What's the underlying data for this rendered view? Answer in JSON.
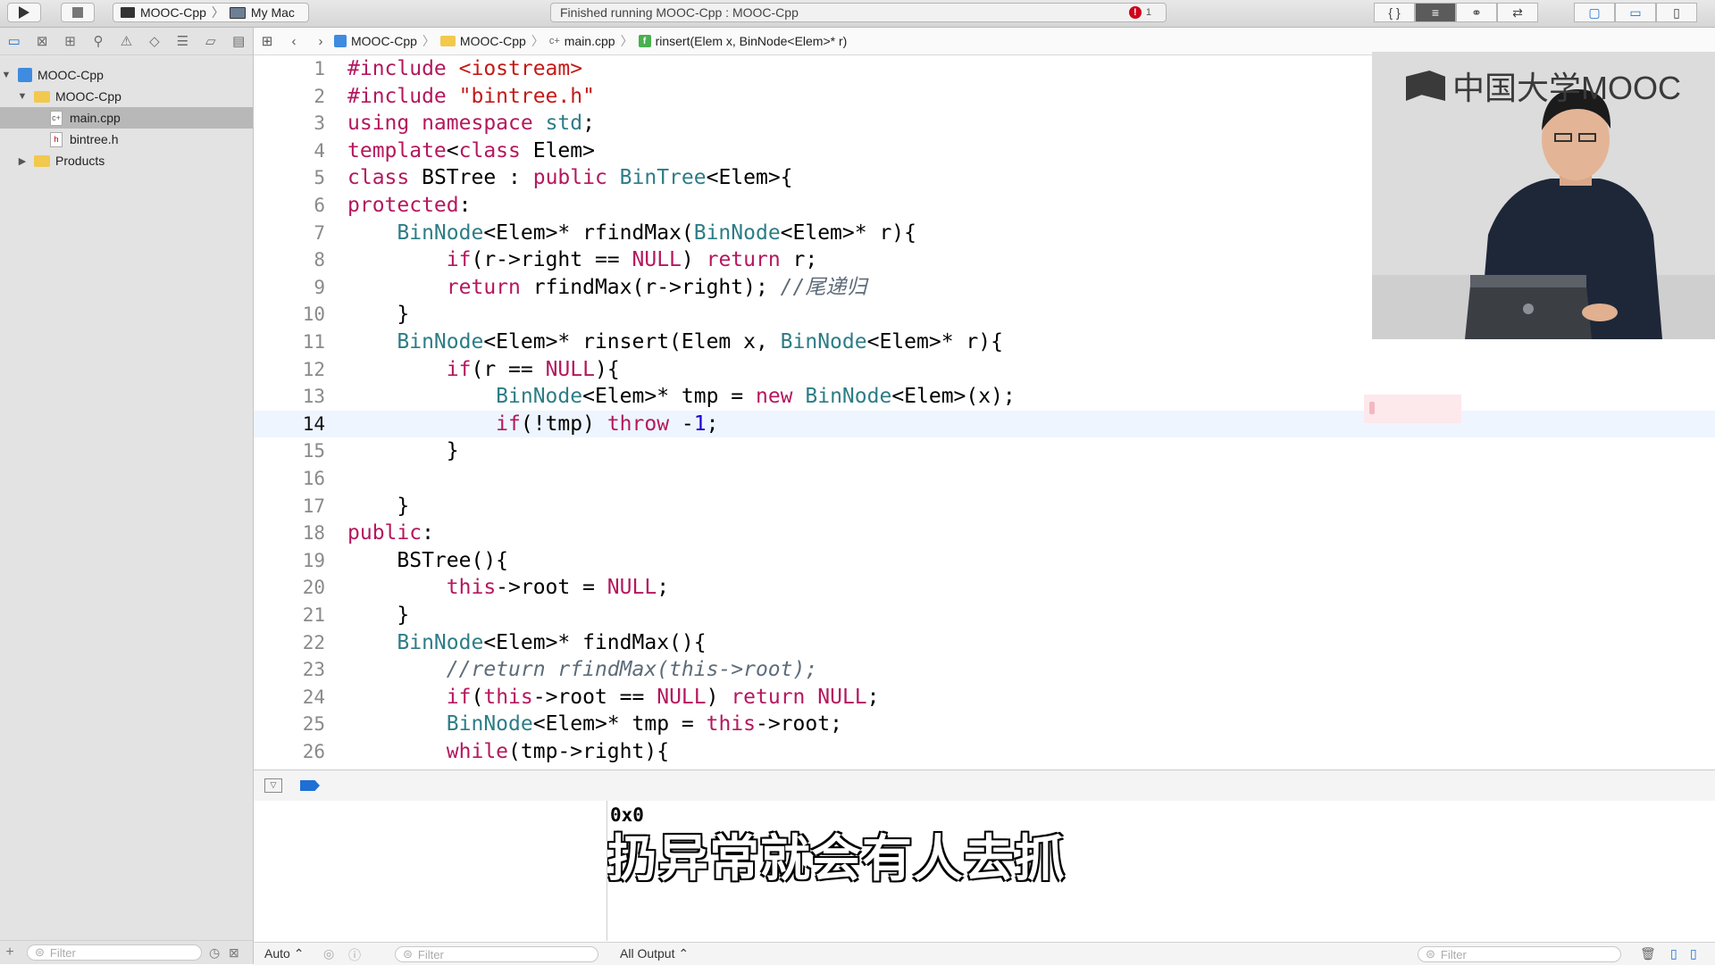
{
  "toolbar": {
    "scheme_name": "MOOC-Cpp",
    "destination": "My Mac",
    "status_text": "Finished running MOOC-Cpp : MOOC-Cpp",
    "error_count": "1",
    "editor_icons": [
      "{ }",
      "≡",
      "⚭",
      "⇄"
    ],
    "view_icons": [
      "▢",
      "▭",
      "▯"
    ]
  },
  "navigator": {
    "icons": [
      "folder-icon",
      "source-control-icon",
      "symbol-icon",
      "find-icon",
      "issue-icon",
      "test-icon",
      "debug-icon",
      "breakpoint-icon",
      "report-icon"
    ],
    "tree": [
      {
        "label": "MOOC-Cpp",
        "kind": "project",
        "depth": 0,
        "expanded": true,
        "selected": false
      },
      {
        "label": "MOOC-Cpp",
        "kind": "folder",
        "depth": 1,
        "expanded": true,
        "selected": false
      },
      {
        "label": "main.cpp",
        "kind": "cpp",
        "depth": 2,
        "selected": true
      },
      {
        "label": "bintree.h",
        "kind": "header",
        "depth": 2,
        "selected": false
      },
      {
        "label": "Products",
        "kind": "folder",
        "depth": 1,
        "expanded": false,
        "selected": false
      }
    ],
    "filter_placeholder": "Filter"
  },
  "jumpbar": {
    "crumbs": [
      "MOOC-Cpp",
      "MOOC-Cpp",
      "main.cpp",
      "rinsert(Elem x, BinNode<Elem>* r)"
    ]
  },
  "editor": {
    "current_line": 14,
    "lines": [
      [
        [
          "#include ",
          "kw"
        ],
        [
          "<iostream>",
          "str"
        ]
      ],
      [
        [
          "#include ",
          "kw"
        ],
        [
          "\"bintree.h\"",
          "str"
        ]
      ],
      [
        [
          "using namespace ",
          "kw"
        ],
        [
          "std",
          "ty"
        ],
        [
          ";",
          ""
        ]
      ],
      [
        [
          "template",
          "kw"
        ],
        [
          "<",
          ""
        ],
        [
          "class ",
          "kw"
        ],
        [
          "Elem>",
          ""
        ]
      ],
      [
        [
          "class ",
          "kw"
        ],
        [
          "BSTree : ",
          ""
        ],
        [
          "public ",
          "kw"
        ],
        [
          "BinTree",
          "ty"
        ],
        [
          "<Elem>{",
          ""
        ]
      ],
      [
        [
          "protected",
          "kw"
        ],
        [
          ":",
          ""
        ]
      ],
      [
        [
          "    ",
          ""
        ],
        [
          "BinNode",
          "ty"
        ],
        [
          "<Elem>* rfindMax(",
          ""
        ],
        [
          "BinNode",
          "ty"
        ],
        [
          "<Elem>* r){",
          ""
        ]
      ],
      [
        [
          "        ",
          ""
        ],
        [
          "if",
          "kw"
        ],
        [
          "(r->right == ",
          ""
        ],
        [
          "NULL",
          "kw"
        ],
        [
          ") ",
          ""
        ],
        [
          "return ",
          "kw"
        ],
        [
          "r;",
          ""
        ]
      ],
      [
        [
          "        ",
          ""
        ],
        [
          "return ",
          "kw"
        ],
        [
          "rfindMax(r->right); ",
          ""
        ],
        [
          "//尾递归",
          "cm"
        ]
      ],
      [
        [
          "    }",
          ""
        ]
      ],
      [
        [
          "    ",
          ""
        ],
        [
          "BinNode",
          "ty"
        ],
        [
          "<Elem>* rinsert(Elem x, ",
          ""
        ],
        [
          "BinNode",
          "ty"
        ],
        [
          "<Elem>* r){",
          ""
        ]
      ],
      [
        [
          "        ",
          ""
        ],
        [
          "if",
          "kw"
        ],
        [
          "(r == ",
          ""
        ],
        [
          "NULL",
          "kw"
        ],
        [
          "){",
          ""
        ]
      ],
      [
        [
          "            ",
          ""
        ],
        [
          "BinNode",
          "ty"
        ],
        [
          "<Elem>* tmp = ",
          ""
        ],
        [
          "new ",
          "kw"
        ],
        [
          "BinNode",
          "ty"
        ],
        [
          "<Elem>(x);",
          ""
        ]
      ],
      [
        [
          "            ",
          ""
        ],
        [
          "if",
          "kw"
        ],
        [
          "(!tmp) ",
          ""
        ],
        [
          "throw ",
          "kw"
        ],
        [
          "-",
          ""
        ],
        [
          "1",
          "num"
        ],
        [
          ";",
          ""
        ]
      ],
      [
        [
          "        }",
          ""
        ]
      ],
      [
        [
          "",
          ""
        ]
      ],
      [
        [
          "    }",
          ""
        ]
      ],
      [
        [
          "public",
          "kw"
        ],
        [
          ":",
          ""
        ]
      ],
      [
        [
          "    BSTree(){",
          ""
        ]
      ],
      [
        [
          "        ",
          ""
        ],
        [
          "this",
          "kw"
        ],
        [
          "->root = ",
          ""
        ],
        [
          "NULL",
          "kw"
        ],
        [
          ";",
          ""
        ]
      ],
      [
        [
          "    }",
          ""
        ]
      ],
      [
        [
          "    ",
          ""
        ],
        [
          "BinNode",
          "ty"
        ],
        [
          "<Elem>* findMax(){",
          ""
        ]
      ],
      [
        [
          "        ",
          ""
        ],
        [
          "//return rfindMax(this->root);",
          "cm"
        ]
      ],
      [
        [
          "        ",
          ""
        ],
        [
          "if",
          "kw"
        ],
        [
          "(",
          ""
        ],
        [
          "this",
          "kw"
        ],
        [
          "->root == ",
          ""
        ],
        [
          "NULL",
          "kw"
        ],
        [
          ") ",
          ""
        ],
        [
          "return ",
          "kw"
        ],
        [
          "NULL",
          "kw"
        ],
        [
          ";",
          ""
        ]
      ],
      [
        [
          "        ",
          ""
        ],
        [
          "BinNode",
          "ty"
        ],
        [
          "<Elem>* tmp = ",
          ""
        ],
        [
          "this",
          "kw"
        ],
        [
          "->root;",
          ""
        ]
      ],
      [
        [
          "        ",
          ""
        ],
        [
          "while",
          "kw"
        ],
        [
          "(tmp->right){",
          ""
        ]
      ]
    ]
  },
  "video": {
    "logo_text": "中国大学MOOC"
  },
  "console": {
    "output": "0x0",
    "subtitle": "扔异常就会有人去抓"
  },
  "bottombar": {
    "auto_label": "Auto ⌃",
    "var_filter_placeholder": "Filter",
    "output_mode": "All Output ⌃",
    "console_filter_placeholder": "Filter"
  },
  "colors": {
    "keyword": "#b4185e",
    "type": "#2d7d86",
    "string": "#c41a16",
    "number": "#1c00cf",
    "comment": "#5d6c79",
    "current_line_bg": "#eef5fe",
    "selection_bg": "#b8b8b8"
  }
}
